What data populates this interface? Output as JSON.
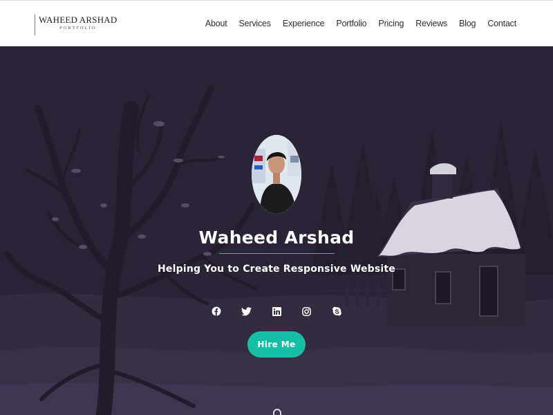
{
  "brand": {
    "name": "WAHEED ARSHAD",
    "subtitle": "PORTFOLIO"
  },
  "nav": {
    "items": [
      {
        "label": "About"
      },
      {
        "label": "Services"
      },
      {
        "label": "Experience"
      },
      {
        "label": "Portfolio"
      },
      {
        "label": "Pricing"
      },
      {
        "label": "Reviews"
      },
      {
        "label": "Blog"
      },
      {
        "label": "Contact"
      }
    ]
  },
  "hero": {
    "name": "Waheed Arshad",
    "tagline": "Helping You to Create Responsive Website",
    "hire_label": "Hire Me",
    "socials": [
      "facebook-icon",
      "twitter-icon",
      "linkedin-icon",
      "instagram-icon",
      "skype-icon"
    ]
  },
  "colors": {
    "accent": "#16bfa4",
    "hero_background": "#2b2336",
    "header_background": "#ffffff"
  }
}
